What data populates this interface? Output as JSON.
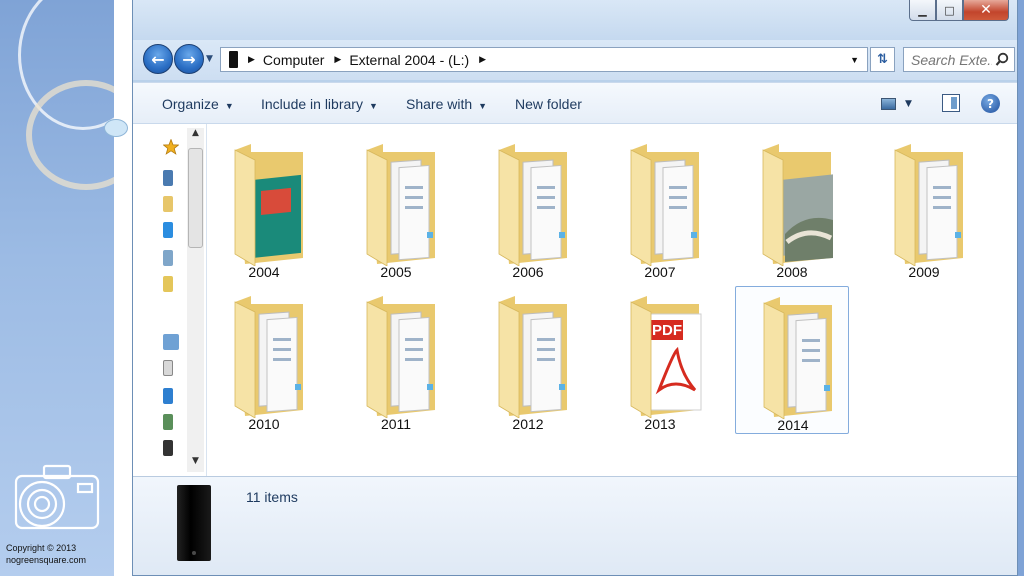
{
  "slide": {
    "copyright_line1": "Copyright © 2013",
    "copyright_line2": "nogreensquare.com"
  },
  "window": {
    "controls": {
      "minimize": "▁",
      "maximize": "□",
      "close": "✕"
    }
  },
  "nav": {
    "back_icon": "back-arrow-icon",
    "forward_icon": "forward-arrow-icon",
    "breadcrumbs": [
      "Computer",
      "External 2004 - (L:)"
    ],
    "search_placeholder": "Search Exte..."
  },
  "toolbar": {
    "organize": "Organize",
    "include_in_library": "Include in library",
    "share_with": "Share with",
    "new_folder": "New folder"
  },
  "colors": {
    "folder_light": "#f6e3a6",
    "folder_dark": "#e9c96e",
    "accent": "#2a6ec4"
  },
  "items": [
    {
      "name": "2004",
      "type": "folder-with-image"
    },
    {
      "name": "2005",
      "type": "folder"
    },
    {
      "name": "2006",
      "type": "folder"
    },
    {
      "name": "2007",
      "type": "folder"
    },
    {
      "name": "2008",
      "type": "folder-with-photo"
    },
    {
      "name": "2009",
      "type": "folder"
    },
    {
      "name": "2010",
      "type": "folder"
    },
    {
      "name": "2011",
      "type": "folder"
    },
    {
      "name": "2012",
      "type": "folder"
    },
    {
      "name": "2013",
      "type": "folder-with-pdf",
      "pdf_label": "PDF"
    },
    {
      "name": "2014",
      "type": "folder",
      "selected": true
    }
  ],
  "details": {
    "item_count": "11 items"
  }
}
